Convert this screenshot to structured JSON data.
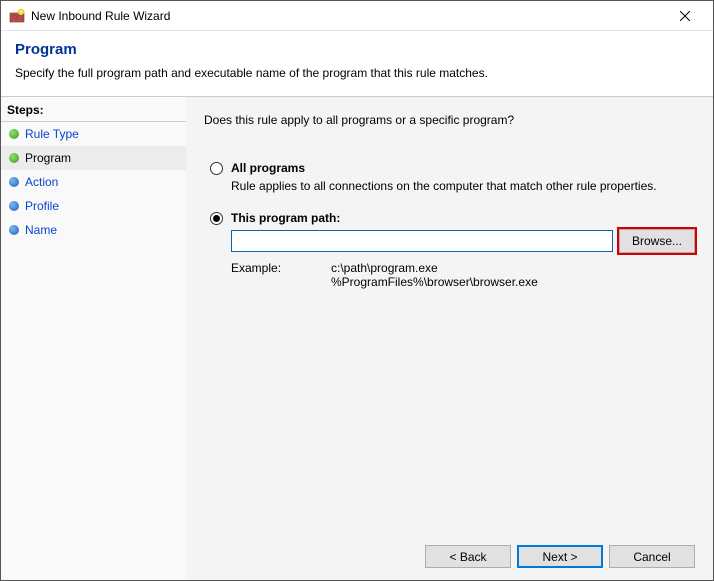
{
  "window": {
    "title": "New Inbound Rule Wizard"
  },
  "header": {
    "title": "Program",
    "subtitle": "Specify the full program path and executable name of the program that this rule matches."
  },
  "sidebar": {
    "heading": "Steps:",
    "items": [
      {
        "label": "Rule Type",
        "state": "done",
        "link": true
      },
      {
        "label": "Program",
        "state": "done",
        "link": false,
        "active": true
      },
      {
        "label": "Action",
        "state": "todo",
        "link": true
      },
      {
        "label": "Profile",
        "state": "todo",
        "link": true
      },
      {
        "label": "Name",
        "state": "todo",
        "link": true
      }
    ]
  },
  "main": {
    "question": "Does this rule apply to all programs or a specific program?",
    "option_all": {
      "label": "All programs",
      "desc": "Rule applies to all connections on the computer that match other rule properties."
    },
    "option_path": {
      "label": "This program path:",
      "value": "",
      "browse": "Browse...",
      "example_label": "Example:",
      "example_paths": "c:\\path\\program.exe\n%ProgramFiles%\\browser\\browser.exe"
    },
    "selected": "path"
  },
  "buttons": {
    "back": "< Back",
    "next": "Next >",
    "cancel": "Cancel"
  }
}
